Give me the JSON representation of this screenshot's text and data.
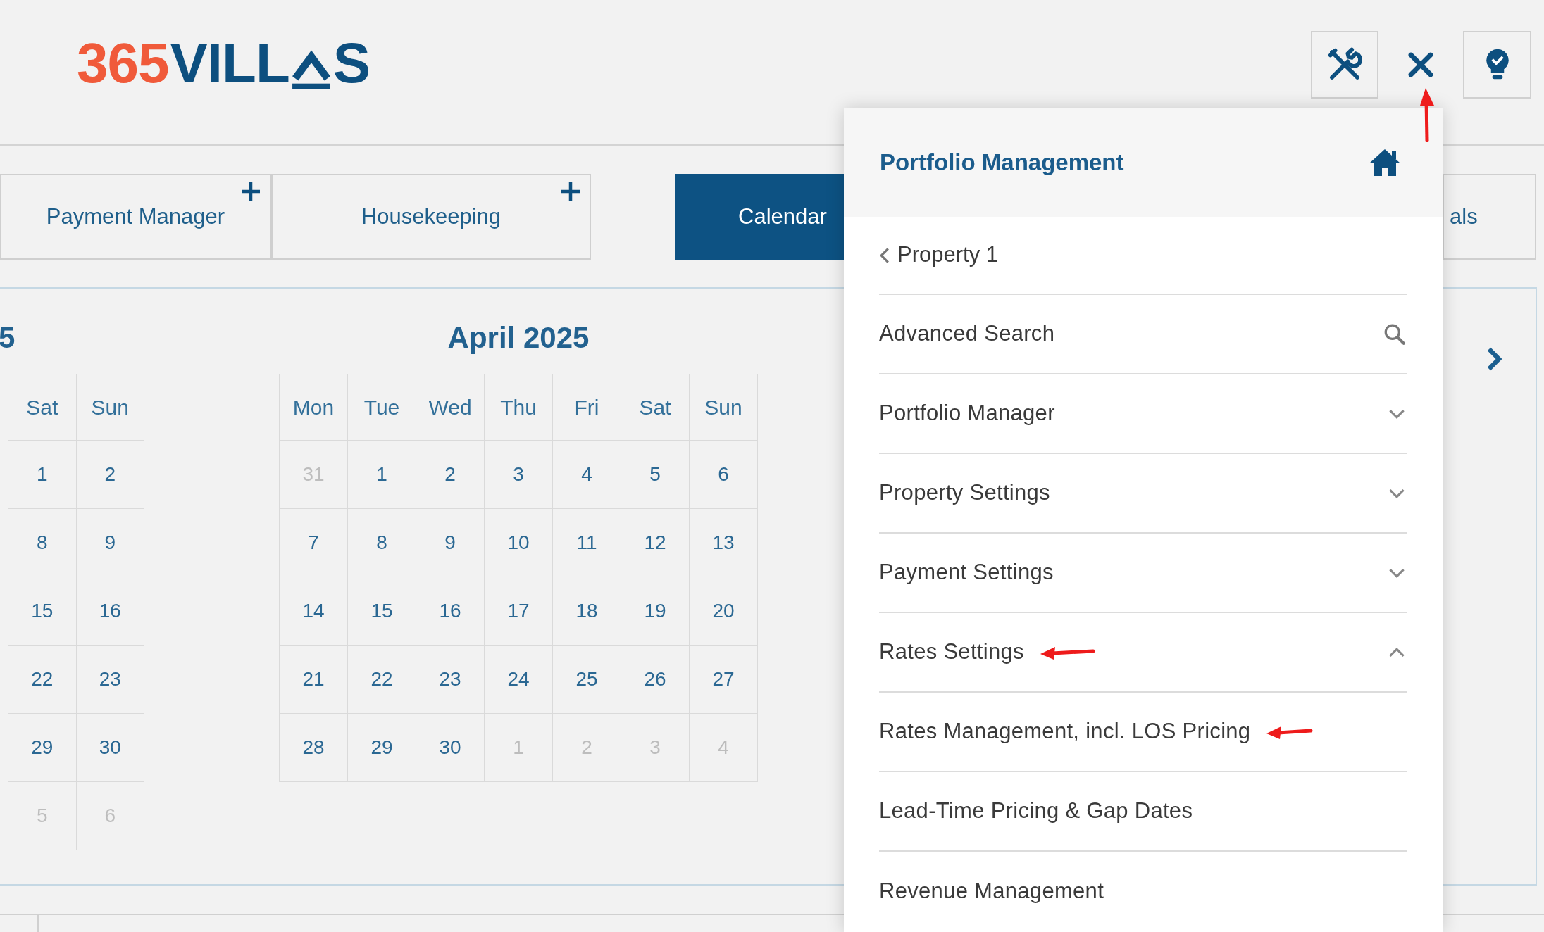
{
  "logo": {
    "number": "365",
    "word_start": "VILL",
    "word_end": "S"
  },
  "close_button": {
    "annotated": true
  },
  "tabs": [
    {
      "label": "Payment Manager",
      "selected": false,
      "addable": true
    },
    {
      "label": "Housekeeping",
      "selected": false,
      "addable": true
    },
    {
      "label": "Calendar",
      "selected": true,
      "addable": false
    },
    {
      "label": "als",
      "selected": false,
      "addable": false
    }
  ],
  "calendars": [
    {
      "title": "5",
      "weekdays": [
        "Sat",
        "Sun"
      ],
      "weeks": [
        [
          {
            "day": "1",
            "outside": false
          },
          {
            "day": "2",
            "outside": false
          }
        ],
        [
          {
            "day": "8",
            "outside": false
          },
          {
            "day": "9",
            "outside": false
          }
        ],
        [
          {
            "day": "15",
            "outside": false
          },
          {
            "day": "16",
            "outside": false
          }
        ],
        [
          {
            "day": "22",
            "outside": false
          },
          {
            "day": "23",
            "outside": false
          }
        ],
        [
          {
            "day": "29",
            "outside": false
          },
          {
            "day": "30",
            "outside": false
          }
        ],
        [
          {
            "day": "5",
            "outside": true
          },
          {
            "day": "6",
            "outside": true
          }
        ]
      ]
    },
    {
      "title": "April 2025",
      "weekdays": [
        "Mon",
        "Tue",
        "Wed",
        "Thu",
        "Fri",
        "Sat",
        "Sun"
      ],
      "weeks": [
        [
          {
            "day": "31",
            "outside": true
          },
          {
            "day": "1",
            "outside": false
          },
          {
            "day": "2",
            "outside": false
          },
          {
            "day": "3",
            "outside": false
          },
          {
            "day": "4",
            "outside": false
          },
          {
            "day": "5",
            "outside": false
          },
          {
            "day": "6",
            "outside": false
          }
        ],
        [
          {
            "day": "7",
            "outside": false
          },
          {
            "day": "8",
            "outside": false
          },
          {
            "day": "9",
            "outside": false
          },
          {
            "day": "10",
            "outside": false
          },
          {
            "day": "11",
            "outside": false
          },
          {
            "day": "12",
            "outside": false
          },
          {
            "day": "13",
            "outside": false
          }
        ],
        [
          {
            "day": "14",
            "outside": false
          },
          {
            "day": "15",
            "outside": false
          },
          {
            "day": "16",
            "outside": false
          },
          {
            "day": "17",
            "outside": false
          },
          {
            "day": "18",
            "outside": false
          },
          {
            "day": "19",
            "outside": false
          },
          {
            "day": "20",
            "outside": false
          }
        ],
        [
          {
            "day": "21",
            "outside": false
          },
          {
            "day": "22",
            "outside": false
          },
          {
            "day": "23",
            "outside": false
          },
          {
            "day": "24",
            "outside": false
          },
          {
            "day": "25",
            "outside": false
          },
          {
            "day": "26",
            "outside": false
          },
          {
            "day": "27",
            "outside": false
          }
        ],
        [
          {
            "day": "28",
            "outside": false
          },
          {
            "day": "29",
            "outside": false
          },
          {
            "day": "30",
            "outside": false
          },
          {
            "day": "1",
            "outside": true
          },
          {
            "day": "2",
            "outside": true
          },
          {
            "day": "3",
            "outside": true
          },
          {
            "day": "4",
            "outside": true
          }
        ]
      ]
    }
  ],
  "menu": {
    "title": "Portfolio Management",
    "back": "Property 1",
    "items": [
      {
        "label": "Advanced Search",
        "kind": "search",
        "annotated": false
      },
      {
        "label": "Portfolio Manager",
        "kind": "group",
        "expanded": false,
        "annotated": false
      },
      {
        "label": "Property Settings",
        "kind": "group",
        "expanded": false,
        "annotated": false
      },
      {
        "label": "Payment Settings",
        "kind": "group",
        "expanded": false,
        "annotated": false
      },
      {
        "label": "Rates Settings",
        "kind": "group",
        "expanded": true,
        "annotated": true
      },
      {
        "label": "Rates Management, incl. LOS Pricing",
        "kind": "link",
        "annotated": true
      },
      {
        "label": "Lead-Time Pricing & Gap Dates",
        "kind": "link",
        "annotated": false
      },
      {
        "label": "Revenue Management",
        "kind": "link",
        "annotated": false
      }
    ]
  }
}
